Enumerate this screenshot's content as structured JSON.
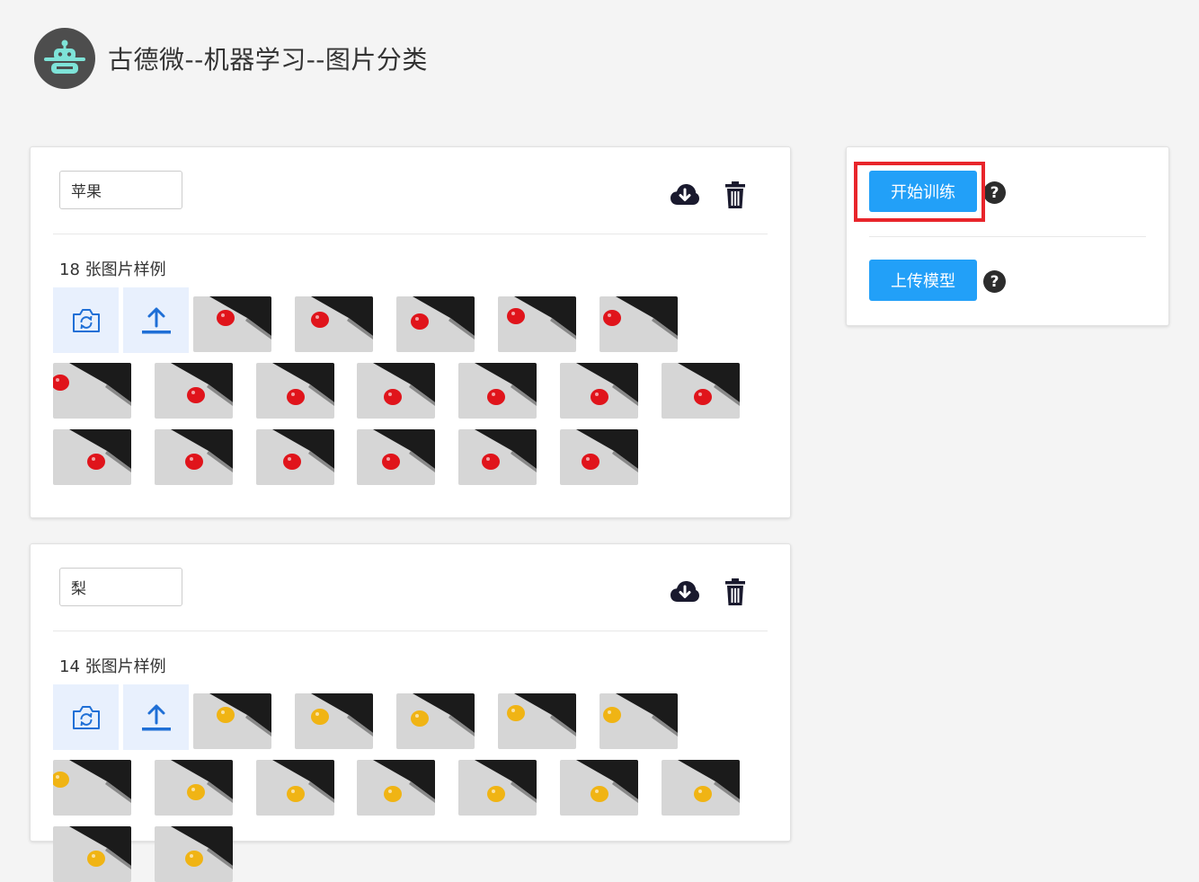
{
  "app": {
    "title": "古德微--机器学习--图片分类"
  },
  "classes": [
    {
      "name": "苹果",
      "count_label": "18 张图片样例",
      "fruit_color": "#e0141b",
      "image_count": 18
    },
    {
      "name": "梨",
      "count_label": "14 张图片样例",
      "fruit_color": "#f0b414",
      "image_count": 14
    }
  ],
  "icons": {
    "logo": "robot-icon",
    "download": "cloud-download-icon",
    "delete": "trash-icon",
    "camera": "camera-switch-icon",
    "upload": "upload-icon",
    "help": "question-circle-icon"
  },
  "sidebar": {
    "train_label": "开始训练",
    "upload_model_label": "上传模型",
    "help_symbol": "?"
  },
  "colors": {
    "primary": "#22a0f8",
    "highlight": "#e8252b",
    "tile_bg": "#e8f0fd",
    "icon_blue": "#1f6fd6"
  }
}
